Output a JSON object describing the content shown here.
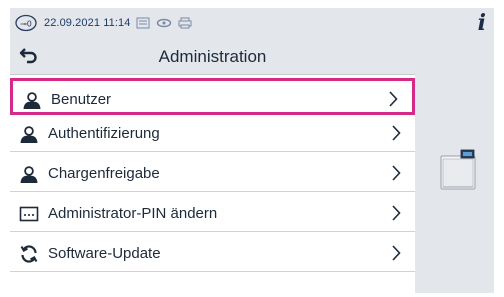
{
  "status": {
    "datetime": "22.09.2021 11:14",
    "info_label": "i"
  },
  "header": {
    "title": "Administration"
  },
  "menu": {
    "items": [
      {
        "label": "Benutzer",
        "icon": "user-icon",
        "selected": true
      },
      {
        "label": "Authentifizierung",
        "icon": "user-icon",
        "selected": false
      },
      {
        "label": "Chargenfreigabe",
        "icon": "user-icon",
        "selected": false
      },
      {
        "label": "Administrator-PIN ändern",
        "icon": "pin-entry-icon",
        "selected": false
      },
      {
        "label": "Software-Update",
        "icon": "refresh-icon",
        "selected": false
      }
    ]
  },
  "colors": {
    "highlight": "#d62a8a",
    "bar": "#e3e6ea",
    "text": "#1d2a3a"
  }
}
